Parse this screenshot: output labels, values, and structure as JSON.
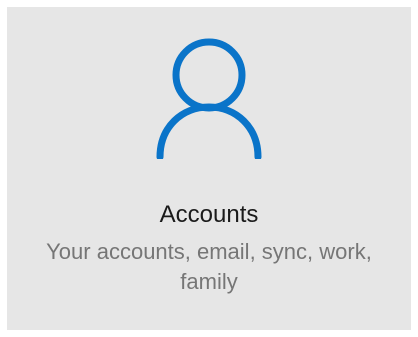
{
  "tile": {
    "icon": "person-icon",
    "accent_color": "#0a74c9",
    "title": "Accounts",
    "description": "Your accounts, email, sync, work, family"
  }
}
